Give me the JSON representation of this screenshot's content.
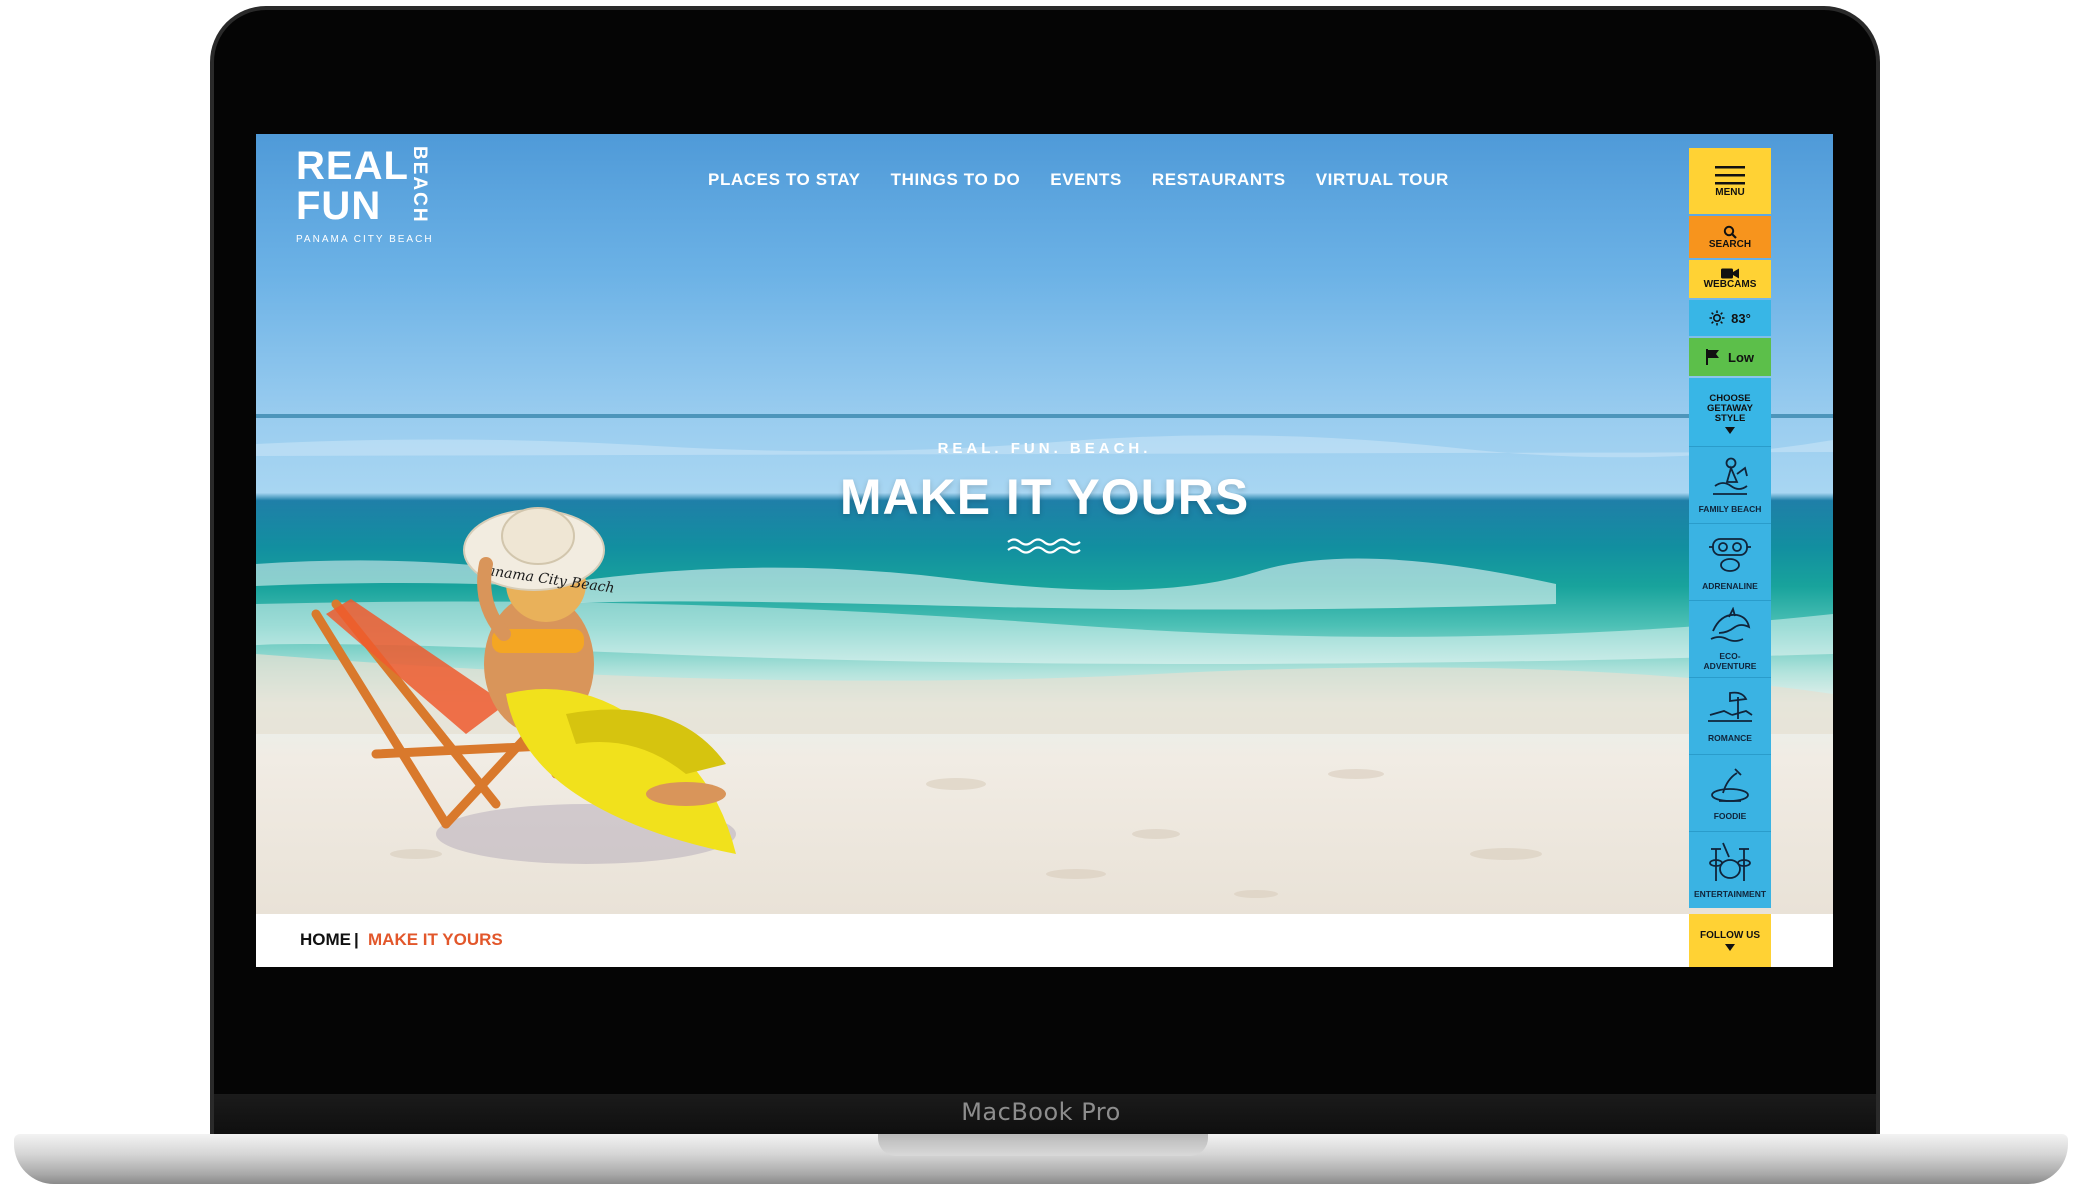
{
  "device": {
    "label": "MacBook Pro"
  },
  "site": {
    "logo": {
      "line1": "REAL",
      "line2": "FUN",
      "vertical": "BEACH",
      "subtitle": "PANAMA CITY BEACH"
    },
    "nav": {
      "items": [
        {
          "label": "PLACES TO STAY"
        },
        {
          "label": "THINGS TO DO"
        },
        {
          "label": "EVENTS"
        },
        {
          "label": "RESTAURANTS"
        },
        {
          "label": "VIRTUAL TOUR"
        }
      ]
    },
    "hero": {
      "kicker": "REAL. FUN. BEACH.",
      "title": "MAKE IT YOURS",
      "hat_text": "Panama City Beach"
    },
    "sidebar": {
      "menu_label": "MENU",
      "search_label": "SEARCH",
      "webcams_label": "WEBCAMS",
      "temperature": "83°",
      "flag_status": "Low",
      "getaway_label_1": "CHOOSE",
      "getaway_label_2": "GETAWAY",
      "getaway_label_3": "STYLE",
      "getaway_items": [
        {
          "label": "FAMILY BEACH",
          "icon": "family-beach-icon"
        },
        {
          "label": "ADRENALINE",
          "icon": "dive-mask-icon"
        },
        {
          "label": "ECO-ADVENTURE",
          "icon": "dolphin-icon"
        },
        {
          "label": "ROMANCE",
          "icon": "lounge-chairs-icon"
        },
        {
          "label": "FOODIE",
          "icon": "plate-icon"
        },
        {
          "label": "ENTERTAINMENT",
          "icon": "drum-kit-icon"
        }
      ],
      "follow_label": "FOLLOW US"
    },
    "breadcrumb": {
      "home": "HOME",
      "separator": "|",
      "current": "MAKE IT YOURS"
    },
    "colors": {
      "yellow": "#ffd234",
      "orange": "#f7941d",
      "blue": "#38b6e6",
      "green": "#5cbf4a",
      "accent_red": "#e2572b"
    }
  }
}
